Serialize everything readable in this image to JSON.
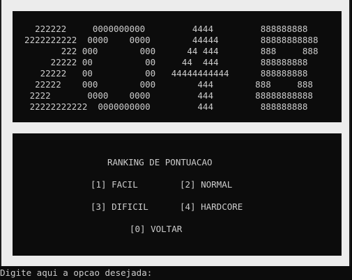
{
  "banner": {
    "lines": [
      "    222222     0000000000         4444         888888888",
      "  2222222222  0000    0000        44444        88888888888",
      "         222 000        000      44 444        888     888",
      "       22222 00          00     44  444        888888888",
      "     22222   00          00   44444444444      888888888",
      "    22222    000        000        444        888     888",
      "   2222       0000    0000         444        88888888888",
      "   22222222222  0000000000         444         888888888"
    ]
  },
  "menu": {
    "title": "RANKING DE PONTUACAO",
    "option_facil": "[1] FACIL",
    "option_normal": "[2] NORMAL",
    "option_dificil": "[3] DIFICIL",
    "option_hardcore": "[4] HARDCORE",
    "option_voltar": "[0] VOLTAR"
  },
  "prompt": {
    "text": "Digite aqui a opcao desejada:"
  },
  "colors": {
    "console_background": "#0c0c0c",
    "console_text": "#cccccc",
    "frame_background": "#ececec"
  }
}
